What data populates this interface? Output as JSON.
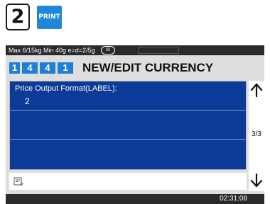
{
  "header": {
    "step_number": "2",
    "print_key_label": "PRINT"
  },
  "status_bar": {
    "spec_text": "Max 6/15kg Min 40g e=d=2/5g",
    "accuracy_class": "III"
  },
  "title_row": {
    "menu_code": [
      "1",
      "4",
      "4",
      "1"
    ],
    "title": "NEW/EDIT CURRENCY"
  },
  "list": {
    "rows": [
      {
        "label": "Price Output Format(LABEL):",
        "value": "2"
      },
      {
        "label": "",
        "value": ""
      },
      {
        "label": "",
        "value": ""
      }
    ]
  },
  "navigation": {
    "page_indicator": "3/3",
    "up_icon": "up-arrow-icon",
    "down_icon": "down-arrow-icon"
  },
  "input_line": {
    "icon": "edit-input-icon",
    "value": ""
  },
  "footer": {
    "clock": "02:31:08"
  },
  "colors": {
    "accent_blue": "#1e7fd6",
    "panel_blue": "#0c3a97",
    "status_bar": "#2a2a2a",
    "screen_bg": "#dedede"
  }
}
